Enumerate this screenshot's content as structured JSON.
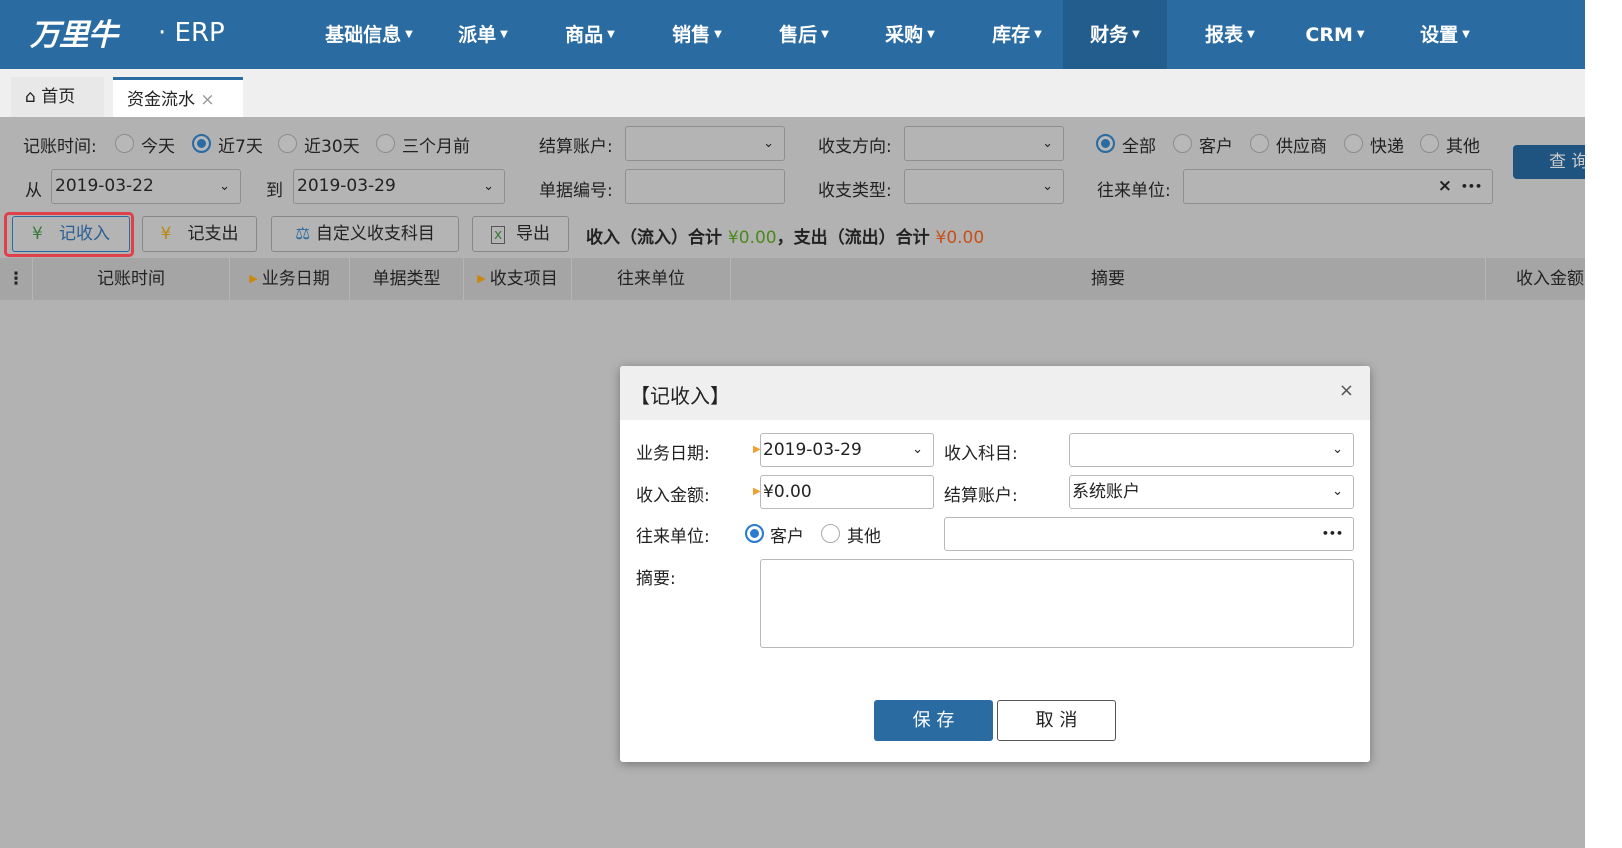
{
  "nav": {
    "logo": "万里牛",
    "brand": "· ERP",
    "items": [
      "基础信息",
      "派单",
      "商品",
      "销售",
      "售后",
      "采购",
      "库存",
      "财务",
      "报表",
      "CRM",
      "设置"
    ],
    "active": "财务"
  },
  "tabs": {
    "home": "首页",
    "current": "资金流水",
    "close": "×"
  },
  "filters": {
    "time_label": "记账时间:",
    "time_options": [
      "今天",
      "近7天",
      "近30天",
      "三个月前"
    ],
    "time_selected": "近7天",
    "account_label": "结算账户:",
    "account_value": "",
    "direction_label": "收支方向:",
    "direction_value": "",
    "party_options": [
      "全部",
      "客户",
      "供应商",
      "快递",
      "其他"
    ],
    "party_selected": "全部",
    "from_label": "从",
    "from_date": "2019-03-22",
    "to_label": "到",
    "to_date": "2019-03-29",
    "doc_no_label": "单据编号:",
    "doc_no_value": "",
    "type_label": "收支类型:",
    "type_value": "",
    "unit_label": "往来单位:",
    "unit_value": "",
    "clear": "×",
    "more": "•••",
    "query": "查 询"
  },
  "toolbar": {
    "income": "记收入",
    "expense": "记支出",
    "custom": "自定义收支科目",
    "export": "导出",
    "yen": "¥",
    "income_total_label": "收入（流入）合计",
    "income_total": "¥0.00",
    "sep": "，",
    "expense_total_label": "支出（流出）合计",
    "expense_total": "¥0.00",
    "income_color": "#4a8a1a",
    "expense_color": "#c8501a"
  },
  "table": {
    "columns": [
      "记账时间",
      "业务日期",
      "单据类型",
      "收支项目",
      "往来单位",
      "摘要",
      "收入金额"
    ]
  },
  "dialog": {
    "title": "【记收入】",
    "close": "×",
    "date_label": "业务日期:",
    "date_value": "2019-03-29",
    "subject_label": "收入科目:",
    "subject_value": "",
    "amount_label": "收入金额:",
    "amount_value": "¥0.00",
    "account_label": "结算账户:",
    "account_value": "系统账户",
    "unit_label": "往来单位:",
    "unit_options": [
      "客户",
      "其他"
    ],
    "unit_selected": "客户",
    "unit_value": "",
    "more": "•••",
    "summary_label": "摘要:",
    "summary_value": "",
    "save": "保 存",
    "cancel": "取 消"
  }
}
